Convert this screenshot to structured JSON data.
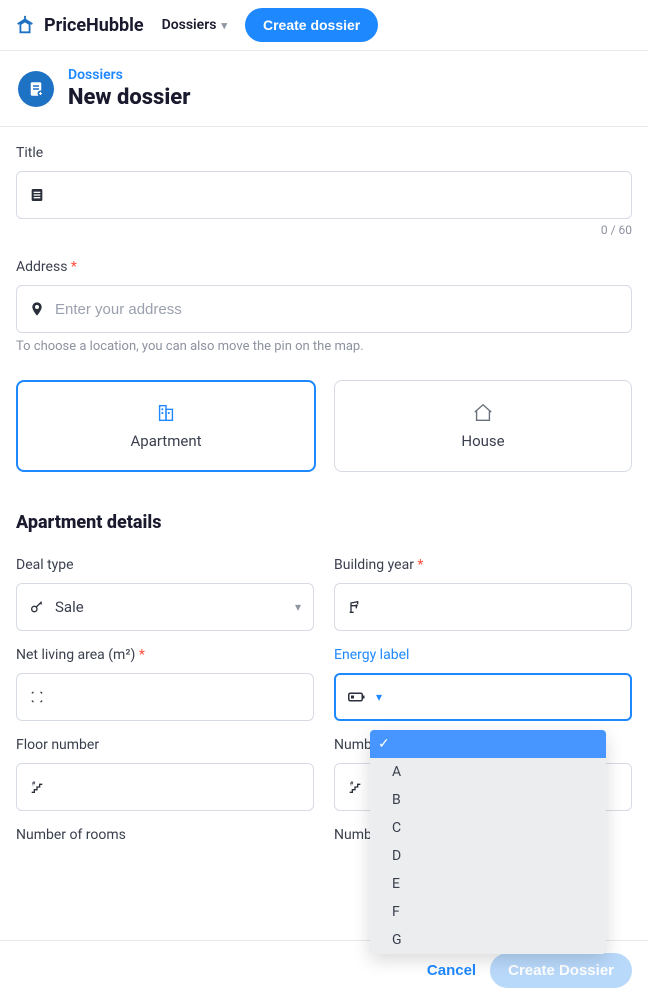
{
  "brand": "PriceHubble",
  "nav": {
    "dossiers": "Dossiers",
    "create": "Create dossier"
  },
  "breadcrumb": "Dossiers",
  "page_title": "New dossier",
  "fields": {
    "title_label": "Title",
    "title_counter": "0 / 60",
    "address_label": "Address",
    "address_placeholder": "Enter your address",
    "address_hint": "To choose a location, you can also move the pin on the map."
  },
  "property_type": {
    "apartment": "Apartment",
    "house": "House"
  },
  "section_title": "Apartment details",
  "details": {
    "deal_type_label": "Deal type",
    "deal_type_value": "Sale",
    "building_year_label": "Building year",
    "net_living_area_label": "Net living area (m²)",
    "energy_label_label": "Energy label",
    "floor_number_label": "Floor number",
    "number_of_label_partial": "Numb",
    "number_of_rooms_label": "Number of rooms",
    "number_of_label_partial2": "Numb"
  },
  "energy_options": [
    "",
    "A",
    "B",
    "C",
    "D",
    "E",
    "F",
    "G"
  ],
  "footer": {
    "cancel": "Cancel",
    "create": "Create Dossier"
  }
}
